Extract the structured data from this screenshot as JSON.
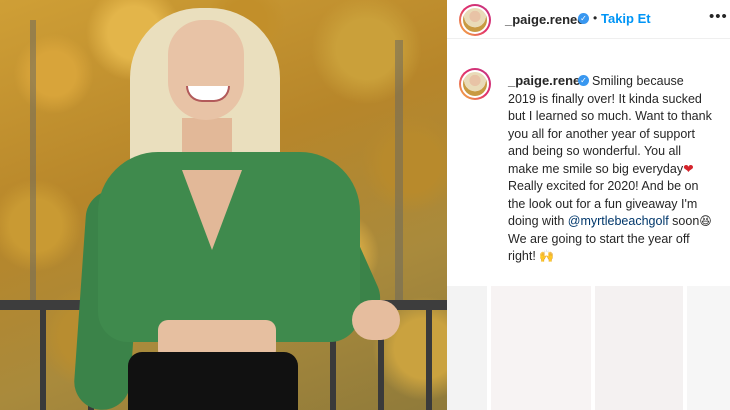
{
  "post": {
    "username": "_paige.renee",
    "verified_icon": "verified-badge-icon",
    "separator": "•",
    "follow_label": "Takip Et",
    "more_label": "•••"
  },
  "caption": {
    "username": "_paige.renee",
    "part1": "Smiling because 2019 is finally over! It kinda sucked but I learned so much. Want to thank you all for another year of support and being so wonderful. You all make me smile so big everyday",
    "heart": "❤",
    "part2": " Really excited for 2020! And be on the look out for a fun giveaway I'm doing with ",
    "mention": "@myrtlebeachgolf",
    "part3": " soon",
    "emoji1": "😆",
    "part4": " We are going to start the year off right! ",
    "emoji2": "🙌"
  },
  "colors": {
    "accent": "#0095f6",
    "verified": "#3897f0",
    "text": "#262626",
    "mention": "#00376b"
  }
}
